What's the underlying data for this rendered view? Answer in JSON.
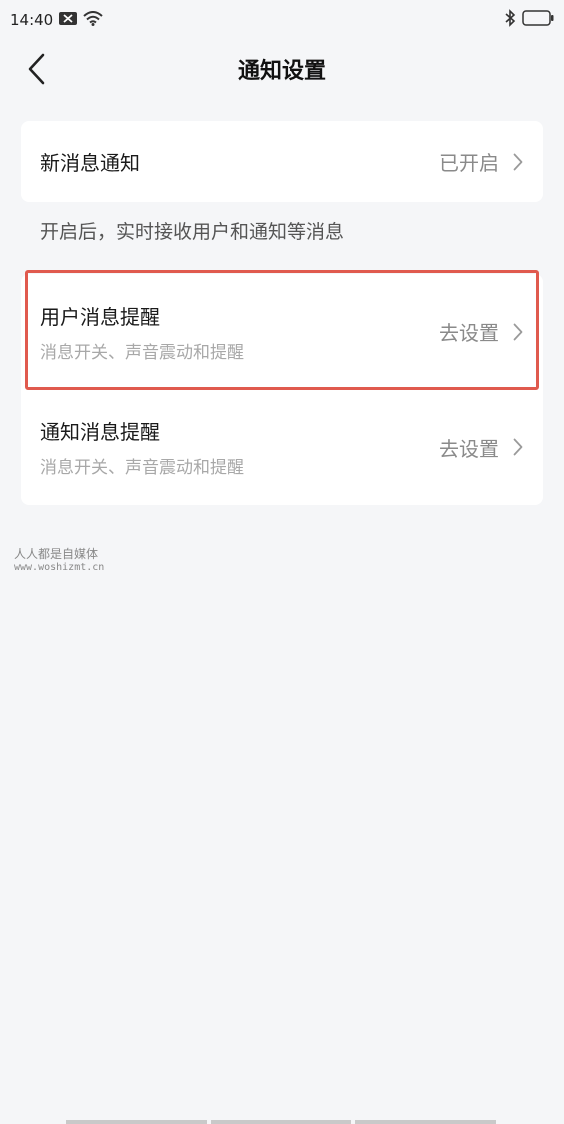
{
  "status_bar": {
    "time": "14:40",
    "icons": [
      "message-icon",
      "wifi-icon",
      "bluetooth-icon",
      "battery-icon"
    ]
  },
  "nav": {
    "title": "通知设置",
    "back_icon": "chevron-left-icon"
  },
  "new_message": {
    "label": "新消息通知",
    "value": "已开启"
  },
  "hint_text": "开启后，实时接收用户和通知等消息",
  "settings": [
    {
      "title": "用户消息提醒",
      "subtitle": "消息开关、声音震动和提醒",
      "action": "去设置",
      "highlighted": true
    },
    {
      "title": "通知消息提醒",
      "subtitle": "消息开关、声音震动和提醒",
      "action": "去设置",
      "highlighted": false
    }
  ],
  "watermark": {
    "line1": "人人都是自媒体",
    "line2": "www.woshizmt.cn"
  },
  "colors": {
    "highlight_border": "#e05a4e",
    "background": "#f5f6f8",
    "card": "#ffffff"
  }
}
